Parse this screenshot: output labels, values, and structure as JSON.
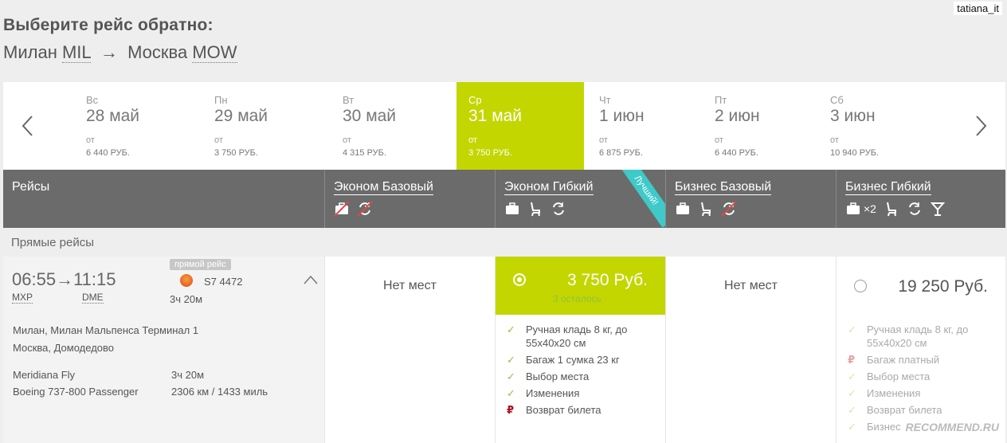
{
  "watermark_user": "tatiana_it",
  "header": {
    "title": "Выберите рейс обратно:",
    "origin_city": "Милан",
    "origin_code": "MIL",
    "arrow": "→",
    "dest_city": "Москва",
    "dest_code": "MOW"
  },
  "dates": [
    {
      "dow": "Вс",
      "date": "28 май",
      "from": "от",
      "price": "6 440 РУБ."
    },
    {
      "dow": "Пн",
      "date": "29 май",
      "from": "от",
      "price": "3 750 РУБ."
    },
    {
      "dow": "Вт",
      "date": "30 май",
      "from": "от",
      "price": "4 315 РУБ."
    },
    {
      "dow": "Ср",
      "date": "31 май",
      "from": "от",
      "price": "3 750 РУБ."
    },
    {
      "dow": "Чт",
      "date": "1 июн",
      "from": "от",
      "price": "6 875 РУБ."
    },
    {
      "dow": "Пт",
      "date": "2 июн",
      "from": "от",
      "price": "6 440 РУБ."
    },
    {
      "dow": "Сб",
      "date": "3 июн",
      "from": "от",
      "price": "10 940 РУБ."
    }
  ],
  "selected_date_index": 3,
  "columns": {
    "flights": "Рейсы",
    "econ_basic": "Эконом Базовый",
    "econ_flex": "Эконом Гибкий",
    "econ_flex_ribbon": "Лучший!",
    "biz_basic": "Бизнес Базовый",
    "biz_flex": "Бизнес Гибкий",
    "biz_flex_bag_count": "×2"
  },
  "section_label": "Прямые рейсы",
  "flight": {
    "badge": "прямой рейс",
    "dep_time": "06:55",
    "arr_time": "11:15",
    "dep_code": "MXP",
    "arr_code": "DME",
    "flight_no": "S7 4472",
    "duration": "3ч 20м",
    "dep_airport": "Милан, Милан Мальпенса Терминал 1",
    "arr_airport": "Москва, Домодедово",
    "operator": "Meridiana Fly",
    "operator_duration": "3ч 20м",
    "aircraft": "Boeing 737-800 Passenger",
    "distance": "2306 км / 1433 миль"
  },
  "fares": {
    "econ_basic_status": "Нет мест",
    "econ_flex_price": "3 750 Руб.",
    "econ_flex_left": "3 осталось",
    "biz_basic_status": "Нет мест",
    "biz_flex_price": "19 250 Руб."
  },
  "econ_flex_features": [
    {
      "mark": "✓",
      "type": "ok",
      "text": "Ручная кладь 8 кг, до 55х40х20 см"
    },
    {
      "mark": "✓",
      "type": "ok",
      "text": "Багаж 1 сумка 23 кг"
    },
    {
      "mark": "✓",
      "type": "ok",
      "text": "Выбор места"
    },
    {
      "mark": "✓",
      "type": "ok",
      "text": "Изменения"
    },
    {
      "mark": "₽",
      "type": "pay",
      "text": "Возврат билета"
    }
  ],
  "biz_flex_features": [
    {
      "mark": "✓",
      "type": "ok",
      "text": "Ручная кладь 8 кг, до 55х40х20 см"
    },
    {
      "mark": "₽",
      "type": "pay",
      "text": "Багаж платный"
    },
    {
      "mark": "✓",
      "type": "ok",
      "text": "Выбор места"
    },
    {
      "mark": "✓",
      "type": "ok",
      "text": "Изменения"
    },
    {
      "mark": "✓",
      "type": "ok",
      "text": "Возврат билета"
    },
    {
      "mark": "✓",
      "type": "ok",
      "text": "Бизнес"
    }
  ],
  "recommend_mark": "RECOMMEND.RU",
  "colors": {
    "accent": "#c3d600",
    "header": "#6b6b6b",
    "ribbon": "#3fc9c9",
    "check": "#8cc63f",
    "pay": "#b0121a"
  }
}
